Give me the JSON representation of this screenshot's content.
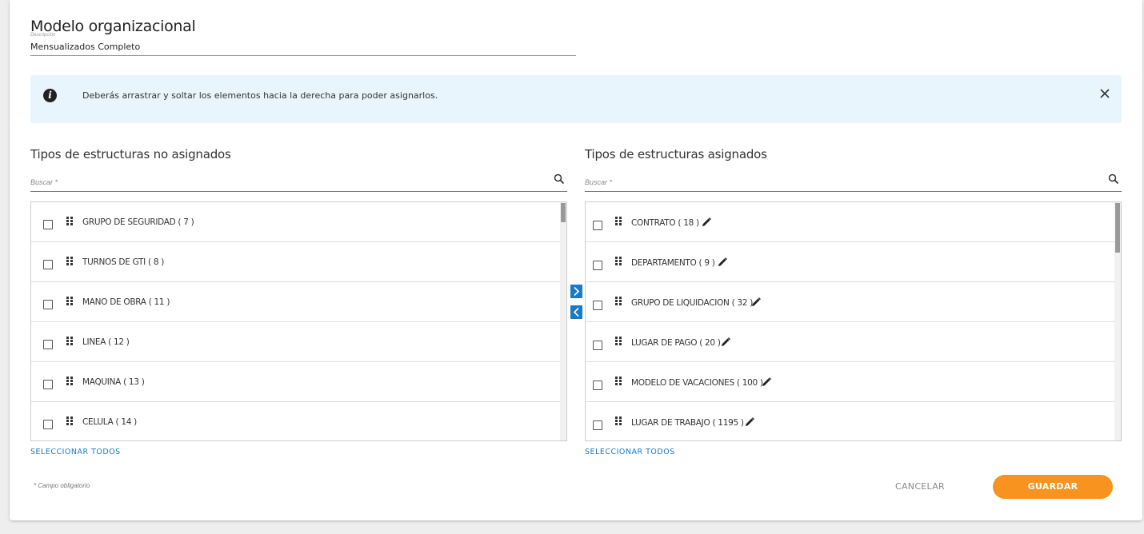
{
  "header": {
    "title": "Modelo organizacional",
    "description_label": "Descripción",
    "description_value": "Mensualizados Completo"
  },
  "alert": {
    "message": "Deberás arrastrar y soltar los elementos hacia la derecha para poder asignarlos.",
    "icon": "info-icon",
    "close_icon": "close-icon"
  },
  "unassigned": {
    "title": "Tipos de estructuras no asignados",
    "search_placeholder": "Buscar *",
    "items": [
      {
        "label": "GRUPO DE SEGURIDAD ( 7 )"
      },
      {
        "label": "TURNOS DE GTI ( 8 )"
      },
      {
        "label": "MANO DE OBRA ( 11 )"
      },
      {
        "label": "LINEA ( 12 )"
      },
      {
        "label": "MAQUINA ( 13 )"
      },
      {
        "label": "CELULA ( 14 )"
      }
    ],
    "select_all": "SELECCIONAR TODOS"
  },
  "assigned": {
    "title": "Tipos de estructuras asignados",
    "search_placeholder": "Buscar *",
    "items": [
      {
        "label": "CONTRATO ( 18 )"
      },
      {
        "label": "DEPARTAMENTO ( 9 )"
      },
      {
        "label": "GRUPO DE LIQUIDACION ( 32 )"
      },
      {
        "label": "LUGAR DE PAGO ( 20 )"
      },
      {
        "label": "MODELO DE VACACIONES ( 100 )"
      },
      {
        "label": "LUGAR DE TRABAJO ( 1195 )"
      }
    ],
    "select_all": "SELECCIONAR TODOS"
  },
  "footer": {
    "required_note": "* Campo obligatorio",
    "cancel": "CANCELAR",
    "save": "GUARDAR"
  },
  "colors": {
    "accent": "#1a7ac4",
    "save_button": "#f7931e",
    "alert_bg": "#e9f5fd"
  }
}
